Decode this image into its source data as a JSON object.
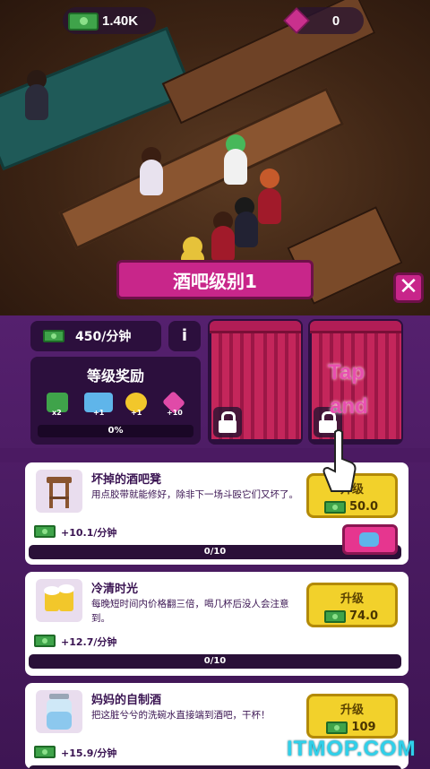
{
  "hud": {
    "cash": "1.40K",
    "gems": "0"
  },
  "level_banner": "酒吧级别1",
  "close_glyph": "✕",
  "rate": "450/分钟",
  "info_glyph": "i",
  "rewards": {
    "title": "等级奖励",
    "items": [
      {
        "icon": "cash-up-icon",
        "label": "x2"
      },
      {
        "icon": "customers-icon",
        "label": "+1"
      },
      {
        "icon": "sparkle-icon",
        "label": "+1"
      },
      {
        "icon": "gem-icon",
        "label": "+10"
      }
    ],
    "progress": "0%"
  },
  "tutorial": {
    "line1": "Tap",
    "line2": "and"
  },
  "upgrades": [
    {
      "title": "坏掉的酒吧凳",
      "desc": "用点胶带就能修好，除非下一场斗殴它们又坏了。",
      "rate": "+10.1/分钟",
      "progress": "0/10",
      "button_label": "升级",
      "cost": "50.0",
      "icon": "bar-stool-icon"
    },
    {
      "title": "冷清时光",
      "desc": "每晚短时间内价格翻三倍，喝几杯后没人会注意到。",
      "rate": "+12.7/分钟",
      "progress": "0/10",
      "button_label": "升级",
      "cost": "74.0",
      "icon": "beer-mugs-icon"
    },
    {
      "title": "妈妈的自制酒",
      "desc": "把这脏兮兮的洗碗水直接端到酒吧，干杯！",
      "rate": "+15.9/分钟",
      "progress": "",
      "button_label": "升级",
      "cost": "109",
      "icon": "jar-icon"
    }
  ],
  "watermark": "ITMOP.COM",
  "colors": {
    "accent_pink": "#c8268a",
    "panel_purple": "#55206e",
    "button_yellow": "#f2d12b",
    "cash_green": "#3fa34a",
    "watermark_cyan": "#2fd0ea"
  }
}
